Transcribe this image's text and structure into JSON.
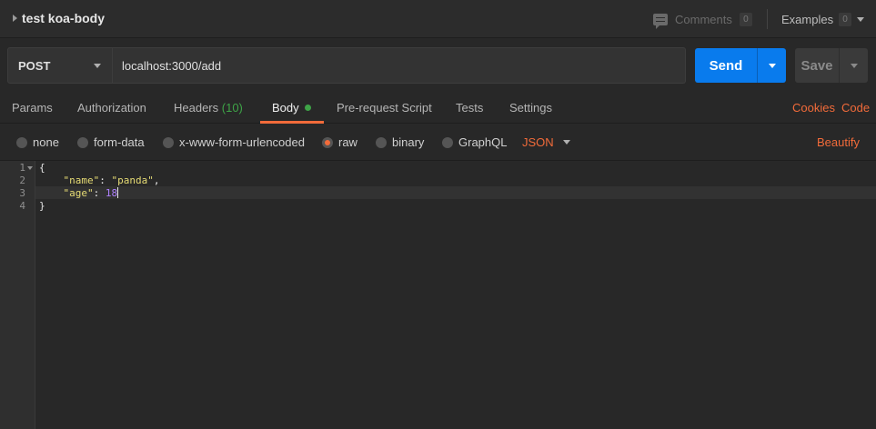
{
  "window": {
    "title": "test koa-body",
    "comments_label": "Comments",
    "comments_count": "0",
    "examples_label": "Examples",
    "examples_count": "0"
  },
  "request": {
    "method": "POST",
    "url": "localhost:3000/add",
    "send_label": "Send",
    "save_label": "Save"
  },
  "tabs": {
    "params": "Params",
    "authorization": "Authorization",
    "headers": "Headers",
    "headers_count": "(10)",
    "body": "Body",
    "prerequest": "Pre-request Script",
    "tests": "Tests",
    "settings": "Settings",
    "cookies": "Cookies",
    "code": "Code",
    "active": "Body"
  },
  "body_options": {
    "none": "none",
    "form_data": "form-data",
    "urlencoded": "x-www-form-urlencoded",
    "raw": "raw",
    "binary": "binary",
    "graphql": "GraphQL",
    "selected": "raw",
    "format": "JSON",
    "beautify": "Beautify"
  },
  "editor": {
    "line_numbers": [
      "1",
      "2",
      "3",
      "4"
    ],
    "lines": {
      "l1": "{",
      "l2_key": "\"name\"",
      "l2_sep": ": ",
      "l2_val": "\"panda\"",
      "l2_end": ",",
      "l3_key": "\"age\"",
      "l3_sep": ": ",
      "l3_val": "18",
      "l4": "}"
    },
    "active_line": "3"
  },
  "colors": {
    "accent": "#f26b3a",
    "send_button": "#097bed",
    "status_green": "#3ea447"
  }
}
